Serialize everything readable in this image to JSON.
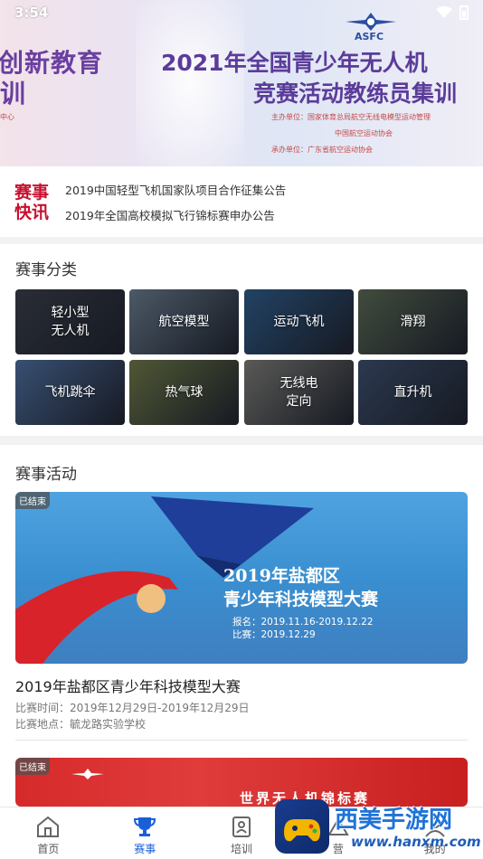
{
  "status": {
    "time": "3:54"
  },
  "banner": {
    "logo_text": "ASFC",
    "left_title": "创新教育",
    "left_sub": "训",
    "main_title": "2021年全国青少年无人机",
    "main_sub": "竞赛活动教练员集训",
    "center_note": "中心",
    "host_line": "主办单位：国家体育总局航空无线电模型运动管理",
    "host_line2": "中国航空运动协会",
    "organizer_line": "承办单位：广东省航空运动协会"
  },
  "news": {
    "badge_line1": "赛事",
    "badge_line2": "快讯",
    "items": [
      "2019中国轻型飞机国家队项目合作征集公告",
      "2019年全国高校模拟飞行锦标赛申办公告"
    ]
  },
  "categories": {
    "title": "赛事分类",
    "items": [
      {
        "label_line1": "轻小型",
        "label_line2": "无人机",
        "color": "#3a3f4a"
      },
      {
        "label_line1": "航空模型",
        "label_line2": "",
        "color": "#6a7c8f"
      },
      {
        "label_line1": "运动飞机",
        "label_line2": "",
        "color": "#2f5d8c"
      },
      {
        "label_line1": "滑翔",
        "label_line2": "",
        "color": "#5b6a55"
      },
      {
        "label_line1": "飞机跳伞",
        "label_line2": "",
        "color": "#4f6f9f"
      },
      {
        "label_line1": "热气球",
        "label_line2": "",
        "color": "#6f7a4a"
      },
      {
        "label_line1": "无线电",
        "label_line2": "定向",
        "color": "#7d7d78"
      },
      {
        "label_line1": "直升机",
        "label_line2": "",
        "color": "#3d4f6e"
      }
    ]
  },
  "activities": {
    "title": "赛事活动",
    "cards": [
      {
        "status": "已结束",
        "poster_title": "2019年盐都区",
        "poster_sub": "青少年科技模型大赛",
        "poster_date1": "报名：2019.11.16-2019.12.22",
        "poster_date2": "比赛：2019.12.29",
        "title": "2019年盐都区青少年科技模型大赛",
        "time": "比赛时间：2019年12月29日-2019年12月29日",
        "place": "比赛地点：毓龙路实验学校"
      },
      {
        "status": "已结束",
        "poster_title": "世界无人机锦标赛"
      }
    ]
  },
  "tabs": [
    {
      "label": "首页",
      "icon": "home-icon"
    },
    {
      "label": "赛事",
      "icon": "trophy-icon",
      "active": true
    },
    {
      "label": "培训",
      "icon": "training-icon"
    },
    {
      "label": "营",
      "icon": "camp-icon"
    },
    {
      "label": "我的",
      "icon": "profile-icon"
    }
  ],
  "watermark": {
    "title": "西美手游网",
    "url": "www.hanxm.com"
  },
  "colors": {
    "accent": "#1a5fd8",
    "news_badge": "#c8102e"
  }
}
